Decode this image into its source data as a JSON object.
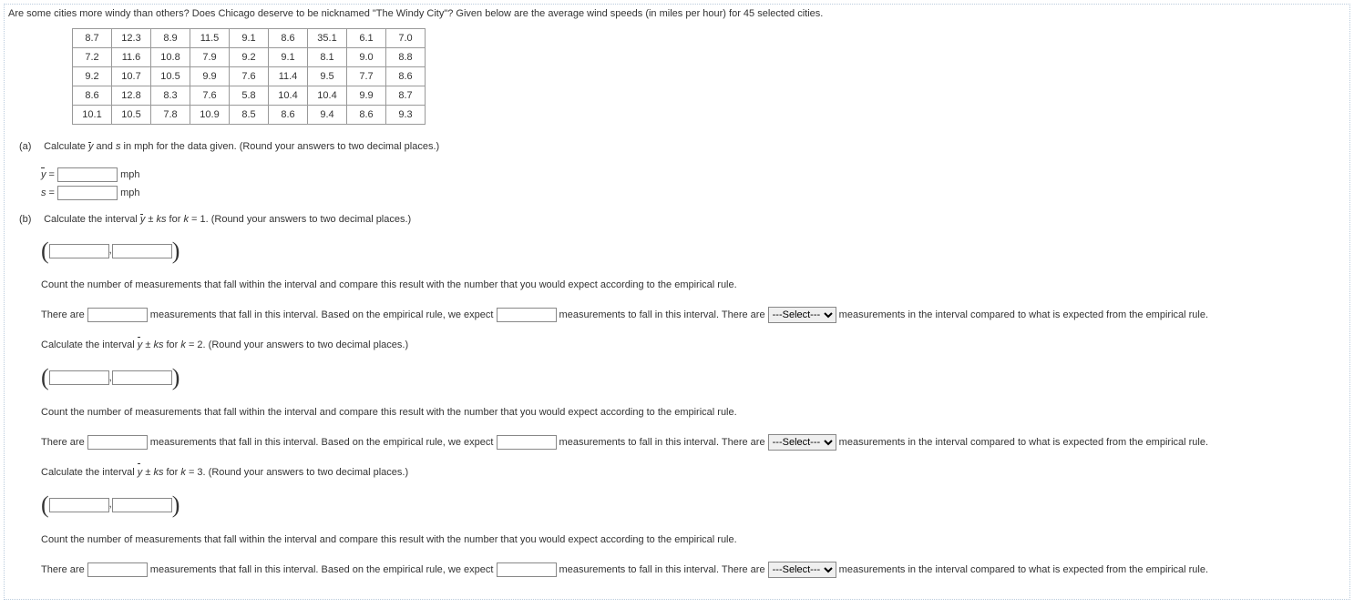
{
  "intro": "Are some cities more windy than others? Does Chicago deserve to be nicknamed \"The Windy City\"? Given below are the average wind speeds (in miles per hour) for 45 selected cities.",
  "table": [
    [
      "8.7",
      "12.3",
      "8.9",
      "11.5",
      "9.1",
      "8.6",
      "35.1",
      "6.1",
      "7.0"
    ],
    [
      "7.2",
      "11.6",
      "10.8",
      "7.9",
      "9.2",
      "9.1",
      "8.1",
      "9.0",
      "8.8"
    ],
    [
      "9.2",
      "10.7",
      "10.5",
      "9.9",
      "7.6",
      "11.4",
      "9.5",
      "7.7",
      "8.6"
    ],
    [
      "8.6",
      "12.8",
      "8.3",
      "7.6",
      "5.8",
      "10.4",
      "10.4",
      "9.9",
      "8.7"
    ],
    [
      "10.1",
      "10.5",
      "7.8",
      "10.9",
      "8.5",
      "8.6",
      "9.4",
      "8.6",
      "9.3"
    ]
  ],
  "parts": {
    "a_label": "(a)",
    "a_text_pre": "Calculate ",
    "a_text_mid": " and ",
    "a_text_post": " in mph for the data given. (Round your answers to two decimal places.)",
    "ybar_eq": " = ",
    "s_eq": " = ",
    "mph": " mph",
    "b_label": "(b)",
    "b_text_pre": "Calculate the interval ",
    "b_text_mid": " ± ",
    "b_text_for": " for ",
    "b_k1": " = 1. (Round your answers to two decimal places.)",
    "b_k2": " = 2. (Round your answers to two decimal places.)",
    "b_k3": " = 3. (Round your answers to two decimal places.)",
    "count_instr": "Count the number of measurements that fall within the interval and compare this result with the number that you would expect according to the empirical rule.",
    "there_are": "There are ",
    "meas_fall": " measurements that fall in this interval. Based on the empirical rule, we expect ",
    "meas_to_fall": " measurements to fall in this interval. There are ",
    "meas_compared": " measurements in the interval compared to what is expected from the empirical rule.",
    "select_placeholder": "---Select---",
    "comma": " , "
  }
}
